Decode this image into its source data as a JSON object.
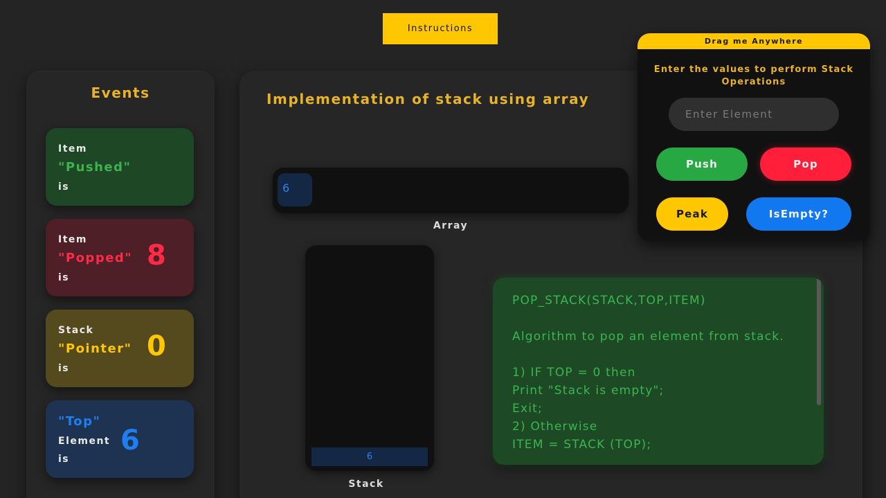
{
  "header": {
    "instructions_label": "Instructions"
  },
  "events": {
    "title": "Events",
    "pushed": {
      "line1": "Item",
      "keyword": "\"Pushed\"",
      "line3": "is",
      "value": ""
    },
    "popped": {
      "line1": "Item",
      "keyword": "\"Popped\"",
      "line3": "is",
      "value": "8"
    },
    "pointer": {
      "line1": "Stack",
      "keyword": "\"Pointer\"",
      "line3": "is",
      "value": "0"
    },
    "top": {
      "keyword": "\"Top\"",
      "line2": "Element",
      "line3": "is",
      "value": "6"
    }
  },
  "main": {
    "title": "Implementation of stack using array",
    "array_cells": [
      "6"
    ],
    "array_label": "Array",
    "stack_cells": [
      "6"
    ],
    "stack_label": "Stack",
    "algorithm": "POP_STACK(STACK,TOP,ITEM)\n\nAlgorithm to pop an element from stack.\n\n1) IF TOP = 0 then\nPrint \"Stack is empty\";\nExit;\n2) Otherwise\nITEM = STACK (TOP);"
  },
  "control": {
    "drag_label": "Drag me Anywhere",
    "caption": "Enter the values to perform Stack Operations",
    "input_placeholder": "Enter Element",
    "input_value": "",
    "push_label": "Push",
    "pop_label": "Pop",
    "peak_label": "Peak",
    "isempty_label": "IsEmpty?"
  },
  "colors": {
    "accent": "#ffc700",
    "push": "#27a843",
    "pop": "#ff1f3a",
    "isempty": "#1278f0",
    "pushed_card": "#1e4726",
    "popped_card": "#4e1f26",
    "pointer_card": "#544a1e",
    "top_card": "#1d3351"
  }
}
